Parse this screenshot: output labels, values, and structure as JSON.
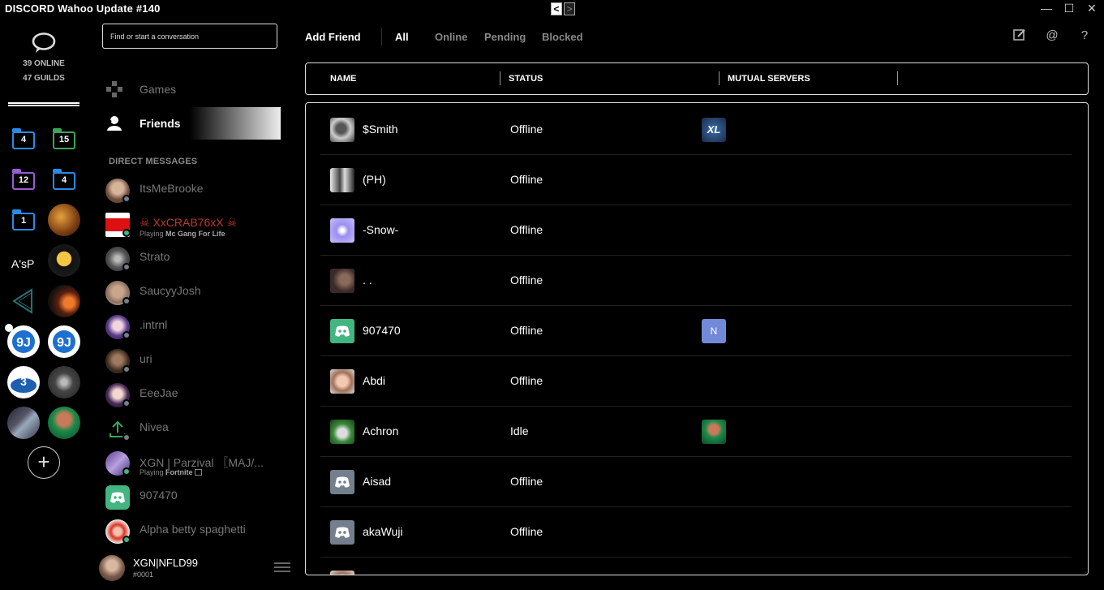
{
  "window": {
    "title": "DISCORD Wahoo Update #140",
    "back_label": "<",
    "forward_label": ">",
    "minimize": "—",
    "maximize": "☐",
    "close": "✕"
  },
  "home": {
    "online": "39 ONLINE",
    "guilds": "47 GUILDS"
  },
  "guilds": {
    "folders": [
      {
        "count": "4",
        "color": "#2a8be6"
      },
      {
        "count": "15",
        "color": "#3ba55c"
      },
      {
        "count": "12",
        "color": "#9a5bd6"
      },
      {
        "count": "4",
        "color": "#2a8be6"
      },
      {
        "count": "1",
        "color": "#2a8be6"
      }
    ],
    "text_server": "A'sP",
    "add_server": "+"
  },
  "search": {
    "placeholder": "Find or start a conversation"
  },
  "nav": {
    "games": "Games",
    "friends": "Friends"
  },
  "direct_messages": {
    "header": "DIRECT MESSAGES",
    "items": [
      {
        "name": "ItsMeBrooke",
        "status": "offline",
        "activity_prefix": "",
        "activity": ""
      },
      {
        "name": "☠ XxCRAB76xX ☠",
        "status": "online",
        "activity_prefix": "Playing",
        "activity": "Mc Gang For Life"
      },
      {
        "name": "Strato",
        "status": "offline",
        "activity_prefix": "",
        "activity": ""
      },
      {
        "name": "SaucyyJosh",
        "status": "offline",
        "activity_prefix": "",
        "activity": ""
      },
      {
        "name": ".intrnl",
        "status": "offline",
        "activity_prefix": "",
        "activity": ""
      },
      {
        "name": "uri",
        "status": "offline",
        "activity_prefix": "",
        "activity": ""
      },
      {
        "name": "EeeJae",
        "status": "offline",
        "activity_prefix": "",
        "activity": ""
      },
      {
        "name": "Nivea",
        "status": "offline",
        "activity_prefix": "",
        "activity": ""
      },
      {
        "name": "XGN | Parzival 〖MAJ/...",
        "status": "online",
        "activity_prefix": "Playing",
        "activity": "Fortnite"
      },
      {
        "name": "907470",
        "status": "none",
        "activity_prefix": "",
        "activity": ""
      },
      {
        "name": "Alpha betty spaghetti",
        "status": "online",
        "activity_prefix": "",
        "activity": ""
      }
    ]
  },
  "user": {
    "username": "XGN|NFLD99",
    "tag": "#0001"
  },
  "topbar": {
    "add_friend": "Add Friend",
    "tabs": [
      "All",
      "Online",
      "Pending",
      "Blocked"
    ],
    "active_tab": "All"
  },
  "table": {
    "headers": [
      "NAME",
      "STATUS",
      "MUTUAL SERVERS"
    ],
    "rows": [
      {
        "name": "$Smith",
        "status": "Offline",
        "mutual": "XL"
      },
      {
        "name": "(PH)",
        "status": "Offline",
        "mutual": ""
      },
      {
        "name": "-Snow-",
        "status": "Offline",
        "mutual": ""
      },
      {
        "name": ". .",
        "status": "Offline",
        "mutual": ""
      },
      {
        "name": "907470",
        "status": "Offline",
        "mutual": "N"
      },
      {
        "name": "Abdi",
        "status": "Offline",
        "mutual": ""
      },
      {
        "name": "Achron",
        "status": "Idle",
        "mutual": "img"
      },
      {
        "name": "Aisad",
        "status": "Offline",
        "mutual": ""
      },
      {
        "name": "akaWuji",
        "status": "Offline",
        "mutual": ""
      }
    ]
  },
  "colors": {
    "online": "#43b581",
    "offline": "#747f8d",
    "blurple": "#7289da",
    "discord_green": "#43b581",
    "discord_gray": "#747f8d"
  }
}
